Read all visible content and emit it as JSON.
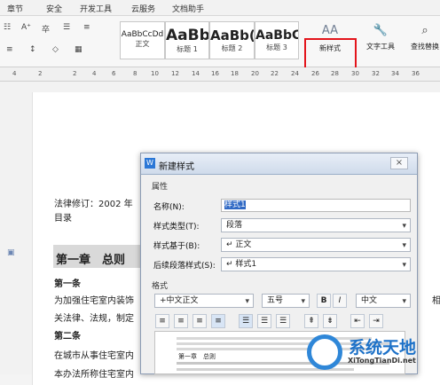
{
  "ribbon_tabs": [
    "章节",
    "安全",
    "开发工具",
    "云服务",
    "文档助手"
  ],
  "styles": [
    {
      "preview": "AaBbCcDd",
      "label": "正文"
    },
    {
      "preview": "AaBb",
      "label": "标题 1"
    },
    {
      "preview": "AaBb(",
      "label": "标题 2"
    },
    {
      "preview": "AaBbC",
      "label": "标题 3"
    }
  ],
  "new_style": {
    "icon": "AA",
    "label": "新样式"
  },
  "text_tools": {
    "label": "文字工具"
  },
  "search_replace": {
    "label": "查找替换"
  },
  "ruler_ticks": [
    "4",
    "2",
    "2",
    "4",
    "6",
    "8",
    "10",
    "12",
    "14",
    "16",
    "18",
    "20",
    "22",
    "24",
    "26",
    "28",
    "30",
    "32",
    "34",
    "36"
  ],
  "document": {
    "law_revision": "法律修订：2002 年",
    "contents": "目录",
    "chapter1": "第一章　总则",
    "article1": "第一条",
    "body1": "为加强住宅室内装饰",
    "body2": "关法律、法规，制定",
    "article2": "第二条",
    "body3": "在城市从事住宅室内",
    "body4": "本办法所称住宅室内",
    "right_text": "相"
  },
  "dialog": {
    "title": "新建样式",
    "properties": "属性",
    "name_label": "名称(N):",
    "name_value": "样式1",
    "type_label": "样式类型(T):",
    "type_value": "段落",
    "based_label": "样式基于(B):",
    "based_value": "↵ 正文",
    "next_label": "后续段落样式(S):",
    "next_value": "↵ 样式1",
    "format": "格式",
    "font_value": "+中文正文",
    "size_value": "五号",
    "bold": "B",
    "italic": "I",
    "lang_value": "中文",
    "preview_heading": "第一章　总则"
  },
  "watermark": {
    "main": "系统天地",
    "sub": "XiTongTianDi.net"
  }
}
